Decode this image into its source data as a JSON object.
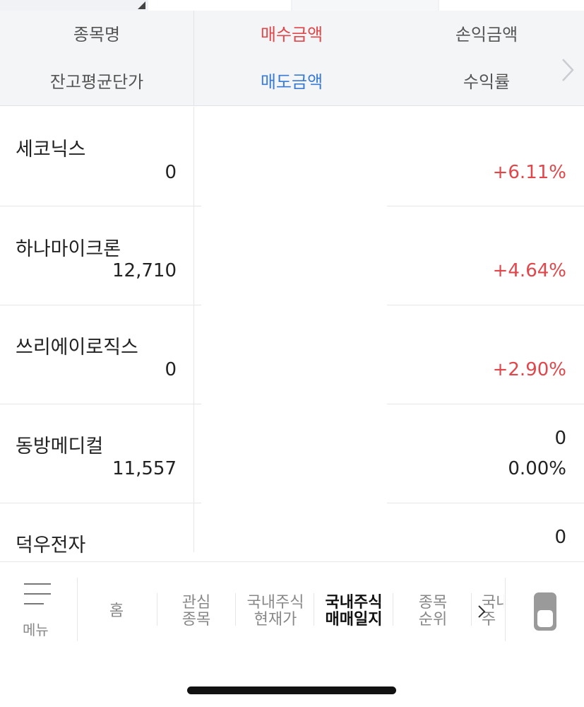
{
  "header": {
    "col1_top": "종목명",
    "col1_bottom": "잔고평균단가",
    "col2_top": "매수금액",
    "col2_bottom": "매도금액",
    "col3_top": "손익금액",
    "col3_bottom": "수익률"
  },
  "rows": [
    {
      "name": "세코닉스",
      "avg_price": "0",
      "right_top": "",
      "right_bottom": "+6.11%",
      "color": "#e0464a"
    },
    {
      "name": "하나마이크론",
      "avg_price": "12,710",
      "right_top": "",
      "right_bottom": "+4.64%",
      "color": "#e0464a"
    },
    {
      "name": "쓰리에이로직스",
      "avg_price": "0",
      "right_top": "",
      "right_bottom": "+2.90%",
      "color": "#e0464a"
    },
    {
      "name": "동방메디컬",
      "avg_price": "11,557",
      "right_top": "0",
      "right_bottom": "0.00%",
      "color": "#222222"
    },
    {
      "name": "덕우전자",
      "avg_price": "",
      "right_top": "0",
      "right_bottom": "",
      "color": "#222222"
    }
  ],
  "bottom_nav": {
    "menu_label": "메뉴",
    "tabs": [
      {
        "line1": "홈",
        "line2": ""
      },
      {
        "line1": "관심",
        "line2": "종목"
      },
      {
        "line1": "국내주식",
        "line2": "현재가"
      },
      {
        "line1": "국내주식",
        "line2": "매매일지"
      },
      {
        "line1": "종목",
        "line2": "순위"
      },
      {
        "line1": "국내",
        "line2": "주"
      }
    ]
  },
  "colors": {
    "positive": "#e0464a",
    "accent_blue": "#3a7bd5",
    "header_bg": "#f4f5f7"
  }
}
